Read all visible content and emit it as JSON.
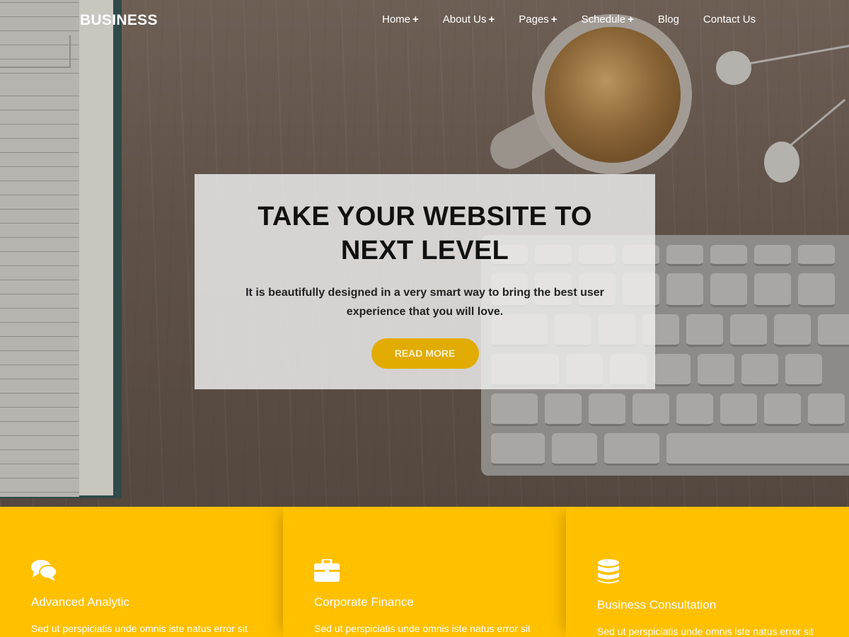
{
  "brand": {
    "logo": "BUSINESS"
  },
  "nav": {
    "items": [
      {
        "label": "Home",
        "has_submenu": true
      },
      {
        "label": "About Us",
        "has_submenu": true
      },
      {
        "label": "Pages",
        "has_submenu": true
      },
      {
        "label": "Schedule",
        "has_submenu": true
      },
      {
        "label": "Blog",
        "has_submenu": false
      },
      {
        "label": "Contact Us",
        "has_submenu": false
      }
    ],
    "submenu_glyph": "+"
  },
  "hero": {
    "title_line1": "TAKE YOUR WEBSITE TO",
    "title_line2": "NEXT LEVEL",
    "subtitle": "It is beautifully designed in a very smart way to bring the best user experience that you will love.",
    "button_label": "READ MORE"
  },
  "features": [
    {
      "icon": "comments-icon",
      "title": "Advanced Analytic",
      "text": "Sed ut perspiciatis unde omnis iste natus error sit voluptatem accusantium doloremque laudantium"
    },
    {
      "icon": "briefcase-icon",
      "title": "Corporate Finance",
      "text": "Sed ut perspiciatis unde omnis iste natus error sit voluptatem accusantium doloremque laudantium"
    },
    {
      "icon": "database-icon",
      "title": "Business Consultation",
      "text": "Sed ut perspiciatis unde omnis iste natus error sit voluptatem accusantium doloremque laudantium"
    }
  ],
  "colors": {
    "accent": "#ffc000",
    "button": "#e2ab00",
    "text_dark": "#111111"
  }
}
